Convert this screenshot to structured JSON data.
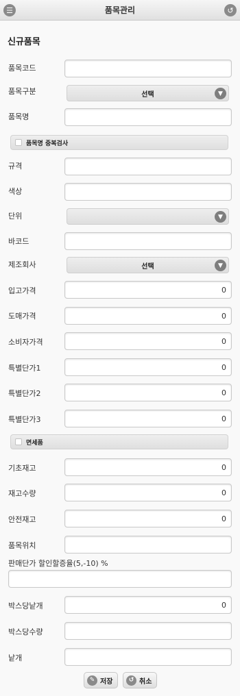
{
  "header": {
    "title": "품목관리",
    "menu_icon": "menu-icon",
    "back_icon": "back-icon"
  },
  "form": {
    "section_title": "신규품목",
    "item_code": {
      "label": "품목코드",
      "value": ""
    },
    "item_category": {
      "label": "품목구분",
      "selected": "선택"
    },
    "item_name": {
      "label": "품목명",
      "value": ""
    },
    "duplicate_check": {
      "label": "품목명 중복검사",
      "checked": false
    },
    "spec": {
      "label": "규격",
      "value": ""
    },
    "color": {
      "label": "색상",
      "value": ""
    },
    "unit": {
      "label": "단위",
      "selected": ""
    },
    "barcode": {
      "label": "바코드",
      "value": ""
    },
    "manufacturer": {
      "label": "제조회사",
      "selected": "선택"
    },
    "purchase_price": {
      "label": "입고가격",
      "value": "0"
    },
    "wholesale_price": {
      "label": "도매가격",
      "value": "0"
    },
    "retail_price": {
      "label": "소비자가격",
      "value": "0"
    },
    "special_price1": {
      "label": "특별단가1",
      "value": "0"
    },
    "special_price2": {
      "label": "특별단가2",
      "value": "0"
    },
    "special_price3": {
      "label": "특별단가3",
      "value": "0"
    },
    "tax_free": {
      "label": "면세품",
      "checked": false
    },
    "base_stock": {
      "label": "기초재고",
      "value": "0"
    },
    "stock_qty": {
      "label": "재고수량",
      "value": "0"
    },
    "safety_stock": {
      "label": "안전재고",
      "value": "0"
    },
    "location": {
      "label": "품목위치",
      "value": ""
    },
    "discount_rate": {
      "label": "판매단가 할인할증율(5,-10) %",
      "value": ""
    },
    "pieces_per_box": {
      "label": "박스당낱개",
      "value": "0"
    },
    "qty_per_box": {
      "label": "박스당수량",
      "value": ""
    },
    "piece": {
      "label": "낱개",
      "value": ""
    }
  },
  "actions": {
    "save": {
      "label": "저장",
      "icon": "pencil-icon"
    },
    "cancel": {
      "label": "취소",
      "icon": "back-arrow-icon"
    }
  }
}
